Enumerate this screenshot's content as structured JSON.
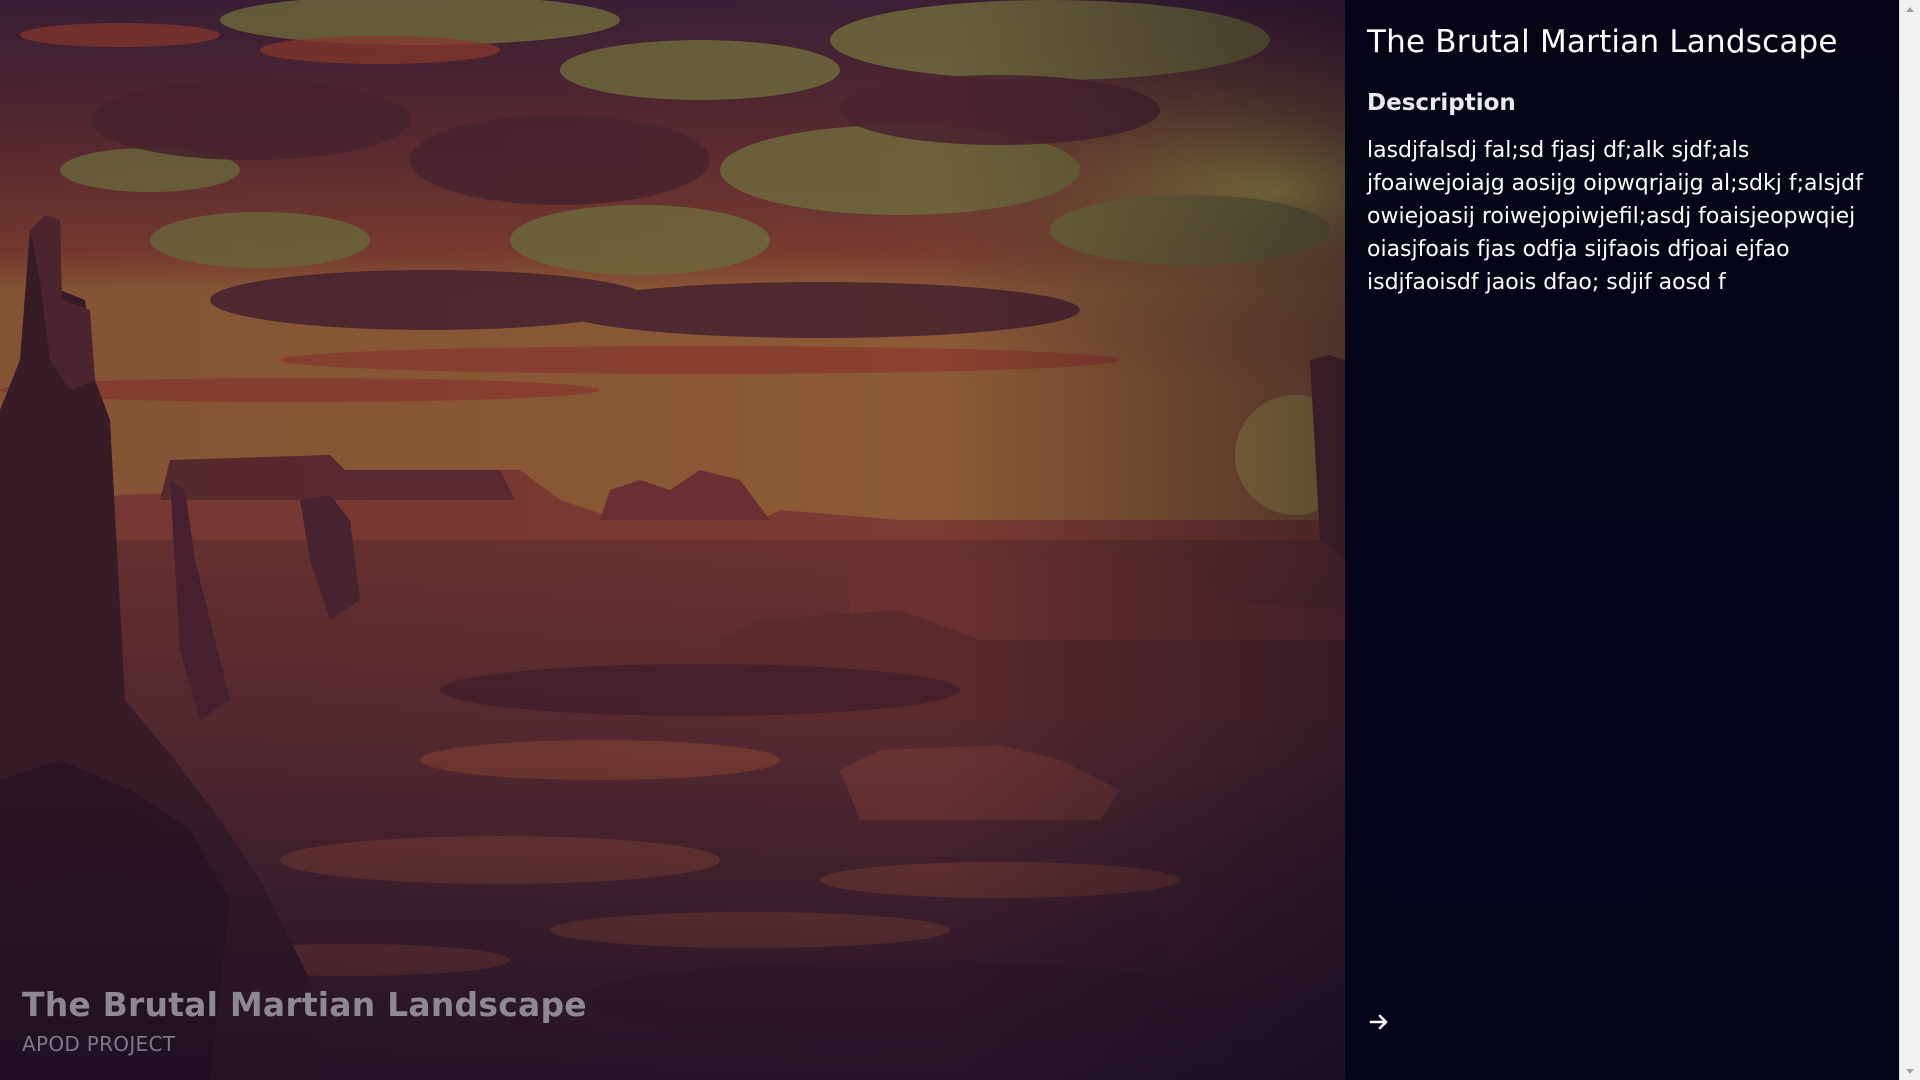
{
  "hero": {
    "title": "The Brutal Martian Landscape",
    "subtitle": "APOD PROJECT",
    "image_subject": "martian-canyon-landscape"
  },
  "panel": {
    "title": "The Brutal Martian Landscape",
    "description_heading": "Description",
    "description_text": "lasdjfalsdj fal;sd fjasj df;alk sjdf;als jfoaiwejoiajg aosijg oipwqrjaijg al;sdkj f;alsjdf owiejoasij roiwejopiwjefil;asdj foaisjeopwqiej oiasjfoais fjas odfja sijfaois dfjoai ejfao isdjfaoisdf jaois dfao; sdjif aosd f",
    "next_icon": "arrow-right-icon"
  },
  "colors": {
    "panel_background": "#050517",
    "hero_tint": "#3b1e2c",
    "sky_accent": "#8a8a45",
    "rock_accent": "#7a3a2e"
  }
}
